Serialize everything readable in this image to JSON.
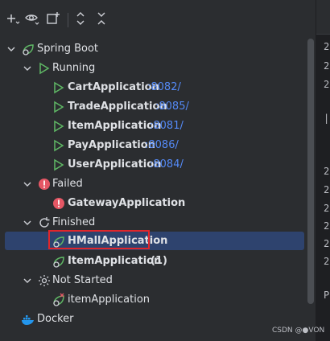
{
  "tree": {
    "rows": [
      {
        "label": "Spring Boot",
        "icon": "spring-boot-icon",
        "chevron": "down"
      },
      {
        "label": "Running",
        "icon": "run-icon",
        "chevron": "down"
      },
      {
        "label": "CartApplication",
        "port": ":8082/",
        "icon": "run-icon"
      },
      {
        "label": "TradeApplication",
        "port": ":8085/",
        "icon": "run-icon"
      },
      {
        "label": "ItemApplication",
        "port": ":8081/",
        "icon": "run-icon"
      },
      {
        "label": "PayApplication",
        "port": ":8086/",
        "icon": "run-icon"
      },
      {
        "label": "UserApplication",
        "port": ":8084/",
        "icon": "run-icon"
      },
      {
        "label": "Failed",
        "icon": "error-icon",
        "chevron": "down"
      },
      {
        "label": "GatewayApplication",
        "icon": "error-icon"
      },
      {
        "label": "Finished",
        "icon": "refresh-icon",
        "chevron": "down"
      },
      {
        "label": "HMallApplication",
        "icon": "spring-app-icon",
        "selected": true
      },
      {
        "label": "ItemApplication",
        "count": "(1)",
        "icon": "spring-app-icon"
      },
      {
        "label": "Not Started",
        "icon": "gear-icon",
        "chevron": "down"
      },
      {
        "label": "itemApplication",
        "icon": "spring-app-error-icon"
      },
      {
        "label": "Docker",
        "icon": "docker-icon"
      }
    ]
  },
  "console": {
    "lines": [
      "2",
      "2",
      "2",
      "|",
      "2",
      "2",
      "2",
      "2",
      "2",
      "2",
      "P"
    ]
  },
  "watermark": "CSDN @●VON",
  "colors": {
    "background": "#2b2d30",
    "selection": "#2e436e",
    "accent": "#548af7",
    "run": "#5fb865",
    "error": "#e55765",
    "highlight_box": "#e0262b"
  }
}
